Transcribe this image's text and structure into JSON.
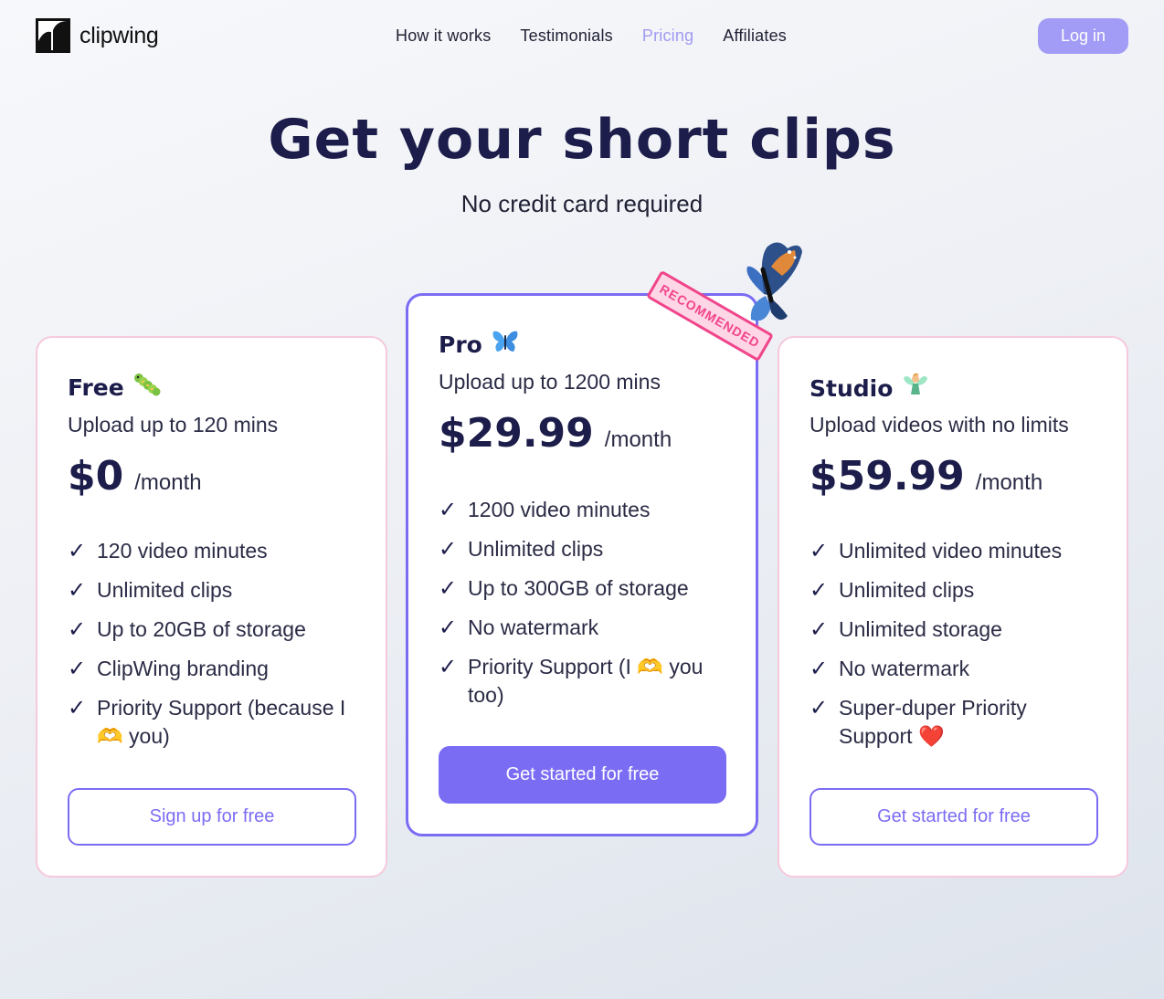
{
  "header": {
    "logo_text": "clipwing",
    "nav": [
      {
        "label": "How it works",
        "active": false
      },
      {
        "label": "Testimonials",
        "active": false
      },
      {
        "label": "Pricing",
        "active": true
      },
      {
        "label": "Affiliates",
        "active": false
      }
    ],
    "login_label": "Log in"
  },
  "hero": {
    "title": "Get your short clips",
    "subtitle": "No credit card required"
  },
  "recommended_badge": "RECOMMENDED",
  "plans": [
    {
      "name": "Free",
      "icon": "caterpillar-icon",
      "description": "Upload up to 120 mins",
      "price": "$0",
      "price_unit": "/month",
      "features": [
        "120 video minutes",
        "Unlimited clips",
        "Up to 20GB of storage",
        "ClipWing branding",
        "Priority Support (because I 🫶 you)"
      ],
      "button_label": "Sign up for free"
    },
    {
      "name": "Pro",
      "icon": "butterfly-icon",
      "description": "Upload up to 1200 mins",
      "price": "$29.99",
      "price_unit": "/month",
      "features": [
        "1200 video minutes",
        "Unlimited clips",
        "Up to 300GB of storage",
        "No watermark",
        "Priority Support (I 🫶 you too)"
      ],
      "button_label": "Get started for free"
    },
    {
      "name": "Studio",
      "icon": "fairy-icon",
      "description": "Upload videos with no limits",
      "price": "$59.99",
      "price_unit": "/month",
      "features": [
        "Unlimited video minutes",
        "Unlimited clips",
        "Unlimited storage",
        "No watermark",
        "Super-duper Priority Support ❤️"
      ],
      "button_label": "Get started for free"
    }
  ],
  "colors": {
    "accent": "#7b6cf4",
    "login_button": "#a39cf6",
    "heading": "#1c1d4a",
    "stamp": "#f0458a",
    "side_card_border": "#f6c9dd"
  }
}
